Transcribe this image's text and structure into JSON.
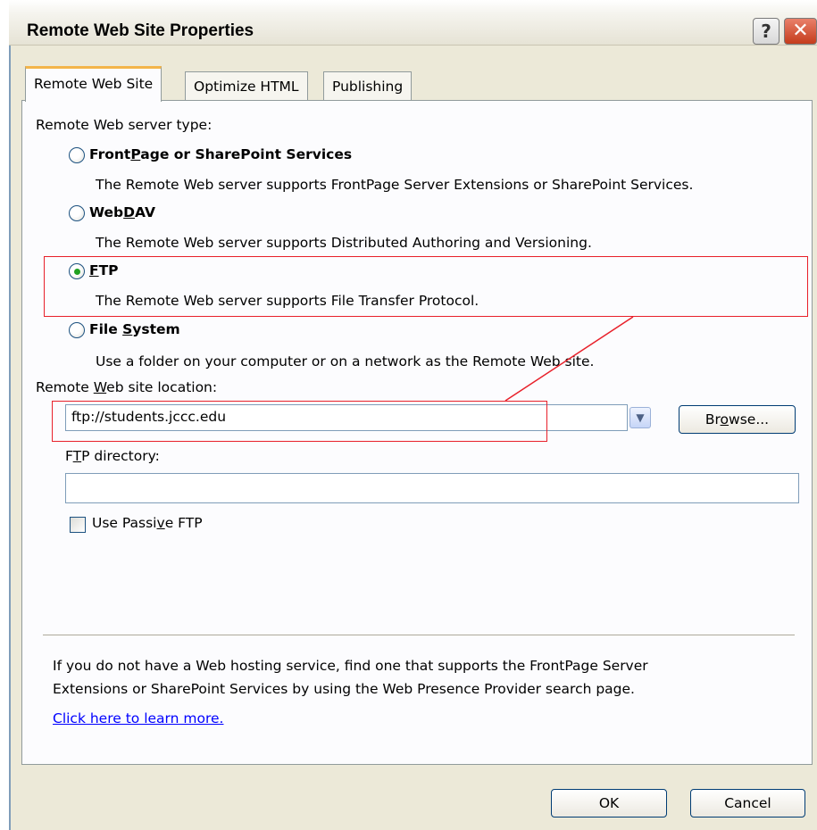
{
  "window": {
    "title": "Remote Web Site Properties",
    "help_glyph": "?",
    "close_glyph": "✕"
  },
  "tabs": [
    {
      "label": "Remote Web Site",
      "active": true
    },
    {
      "label": "Optimize HTML",
      "active": false
    },
    {
      "label": "Publishing",
      "active": false
    }
  ],
  "server_type": {
    "heading": "Remote Web server type:",
    "options": [
      {
        "label": "FrontPage or SharePoint Services",
        "description": "The Remote Web server supports FrontPage Server Extensions or SharePoint Services.",
        "selected": false
      },
      {
        "label": "WebDAV",
        "description": "The Remote Web server supports Distributed Authoring and Versioning.",
        "selected": false
      },
      {
        "label": "FTP",
        "description": "The Remote Web server supports File Transfer Protocol.",
        "selected": true
      },
      {
        "label": "File System",
        "description": "Use a folder on your computer or on a network as the Remote Web site.",
        "selected": false
      }
    ]
  },
  "location": {
    "label": "Remote Web site location:",
    "value": "ftp://students.jccc.edu",
    "browse_label": "Browse..."
  },
  "ftp_directory": {
    "label": "FTP directory:",
    "value": ""
  },
  "passive_ftp": {
    "label": "Use Passive FTP",
    "checked": false
  },
  "info": {
    "line1": "If you do not have a Web hosting service, find one that supports the FrontPage Server",
    "line2": "Extensions or SharePoint Services by using the Web Presence Provider search page.",
    "link": "Click here to learn more."
  },
  "footer": {
    "ok_label": "OK",
    "cancel_label": "Cancel"
  },
  "annotation_color": "#e8202a"
}
